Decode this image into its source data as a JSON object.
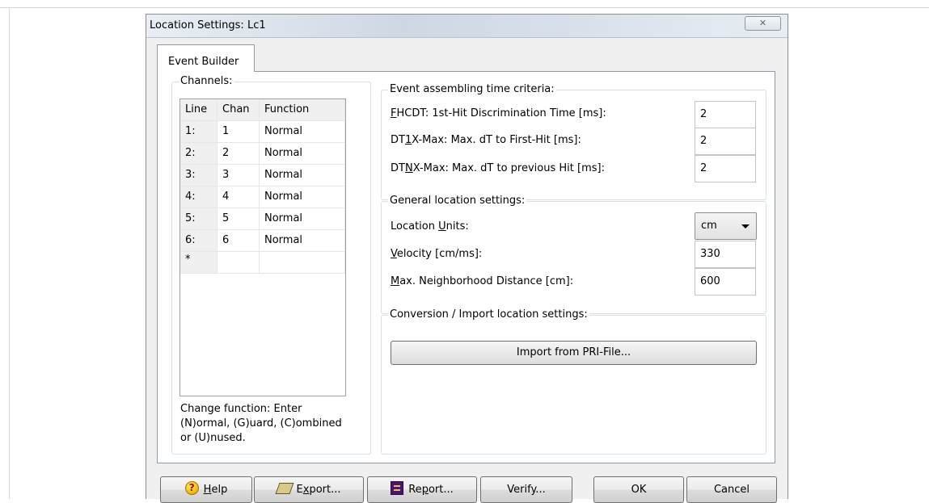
{
  "window": {
    "title": "Location Settings: Lc1",
    "close_glyph": "✕"
  },
  "tabs": [
    {
      "label": "Event Builder"
    }
  ],
  "channels": {
    "group_label": "Channels:",
    "columns": [
      "Line",
      "Chan",
      "Function"
    ],
    "rows": [
      {
        "line": "1:",
        "chan": "1",
        "function": "Normal"
      },
      {
        "line": "2:",
        "chan": "2",
        "function": "Normal"
      },
      {
        "line": "3:",
        "chan": "3",
        "function": "Normal"
      },
      {
        "line": "4:",
        "chan": "4",
        "function": "Normal"
      },
      {
        "line": "5:",
        "chan": "5",
        "function": "Normal"
      },
      {
        "line": "6:",
        "chan": "6",
        "function": "Normal"
      }
    ],
    "new_row_marker": "*",
    "hint_lines": [
      "Change function: Enter",
      "(N)ormal, (G)uard, (C)ombined",
      "or (U)nused."
    ]
  },
  "timing": {
    "group_label": "Event assembling time criteria:",
    "fhcdt": {
      "mnemonic": "F",
      "rest": "HCDT: 1st-Hit Discrimination Time [ms]:",
      "value": "2"
    },
    "dt1x": {
      "pre": "DT",
      "mnemonic": "1",
      "rest": "X-Max: Max. dT to First-Hit [ms]:",
      "value": "2"
    },
    "dtnx": {
      "pre": "DT",
      "mnemonic": "N",
      "rest": "X-Max: Max. dT to previous Hit [ms]:",
      "value": "2"
    }
  },
  "general": {
    "group_label": "General location settings:",
    "units": {
      "pre": "Location ",
      "mnemonic": "U",
      "rest": "nits:",
      "value": "cm"
    },
    "velocity": {
      "mnemonic": "V",
      "rest": "elocity [cm/ms]:",
      "value": "330"
    },
    "neighborhood": {
      "mnemonic": "M",
      "rest": "ax. Neighborhood Distance [cm]:",
      "value": "600"
    }
  },
  "conversion": {
    "group_label": "Conversion / Import location settings:",
    "import_label": "Import from PRI-File..."
  },
  "buttons": {
    "help": {
      "icon": "help-icon",
      "mnemonic": "H",
      "rest": "elp"
    },
    "export": {
      "icon": "export-icon",
      "pre": "E",
      "mnemonic": "x",
      "rest": "port..."
    },
    "report": {
      "icon": "report-icon",
      "pre": "Re",
      "mnemonic": "p",
      "rest": "ort..."
    },
    "verify": {
      "label": "Verify..."
    },
    "ok": {
      "label": "OK"
    },
    "cancel": {
      "label": "Cancel"
    }
  }
}
